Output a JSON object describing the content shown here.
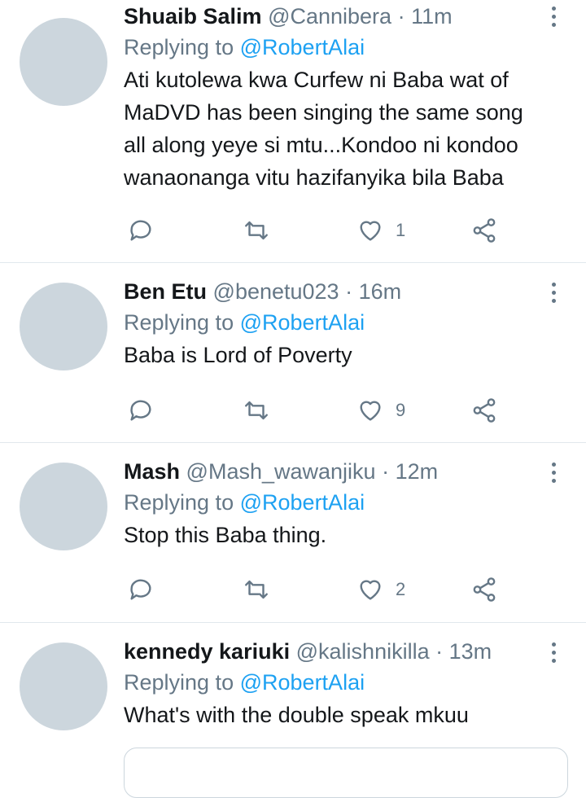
{
  "tweets": [
    {
      "name": "Shuaib Salim",
      "handle": "@Cannibera",
      "separator": "·",
      "time": "11m",
      "replying_prefix": "Replying to",
      "replying_to": "@RobertAlai",
      "lines": [
        "Ati kutolewa kwa Curfew ni Baba wat of",
        "MaDVD has been singing the same song",
        "all along yeye si mtu...Kondoo ni kondoo",
        "wanaonanga vitu hazifanyika bila Baba"
      ],
      "like_count": "1"
    },
    {
      "name": "Ben Etu",
      "handle": "@benetu023",
      "separator": "·",
      "time": "16m",
      "replying_prefix": "Replying to",
      "replying_to": "@RobertAlai",
      "lines": [
        "Baba is Lord of Poverty"
      ],
      "like_count": "9"
    },
    {
      "name": "Mash",
      "handle": "@Mash_wawanjiku",
      "separator": "·",
      "time": "12m",
      "replying_prefix": "Replying to",
      "replying_to": "@RobertAlai",
      "lines": [
        "Stop this Baba thing."
      ],
      "like_count": "2"
    },
    {
      "name": "kennedy kariuki",
      "handle": "@kalishnikilla",
      "separator": "·",
      "time": "13m",
      "replying_prefix": "Replying to",
      "replying_to": "@RobertAlai",
      "lines": [
        "What's with the double speak mkuu"
      ]
    }
  ],
  "icons": {
    "reply": "reply-icon",
    "retweet": "retweet-icon",
    "like": "heart-icon",
    "share": "share-icon",
    "more": "more-vertical-icon"
  },
  "colors": {
    "link": "#1da1f2",
    "secondary_text": "#657786",
    "avatar_placeholder": "#ccd6dd",
    "divider": "#e1e8ed"
  }
}
